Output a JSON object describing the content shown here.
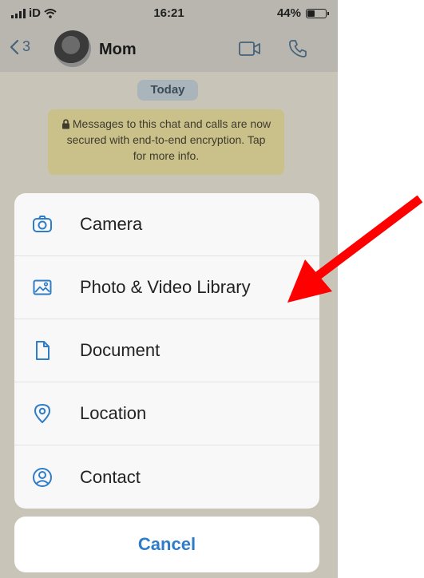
{
  "status_bar": {
    "carrier": "iD",
    "time": "16:21",
    "battery_percent": "44%",
    "battery_level": 0.44
  },
  "nav": {
    "back_count": "3",
    "contact_name": "Mom"
  },
  "chat": {
    "date_chip": "Today",
    "system_message": "Messages to this chat and calls are now secured with end-to-end encryption. Tap for more info."
  },
  "action_sheet": {
    "items": [
      {
        "label": "Camera",
        "icon": "camera-icon"
      },
      {
        "label": "Photo & Video Library",
        "icon": "photo-icon"
      },
      {
        "label": "Document",
        "icon": "document-icon"
      },
      {
        "label": "Location",
        "icon": "location-pin-icon"
      },
      {
        "label": "Contact",
        "icon": "contact-icon"
      }
    ],
    "cancel_label": "Cancel"
  },
  "colors": {
    "accent": "#2f7cc9",
    "annotation_arrow": "#ff0000"
  }
}
